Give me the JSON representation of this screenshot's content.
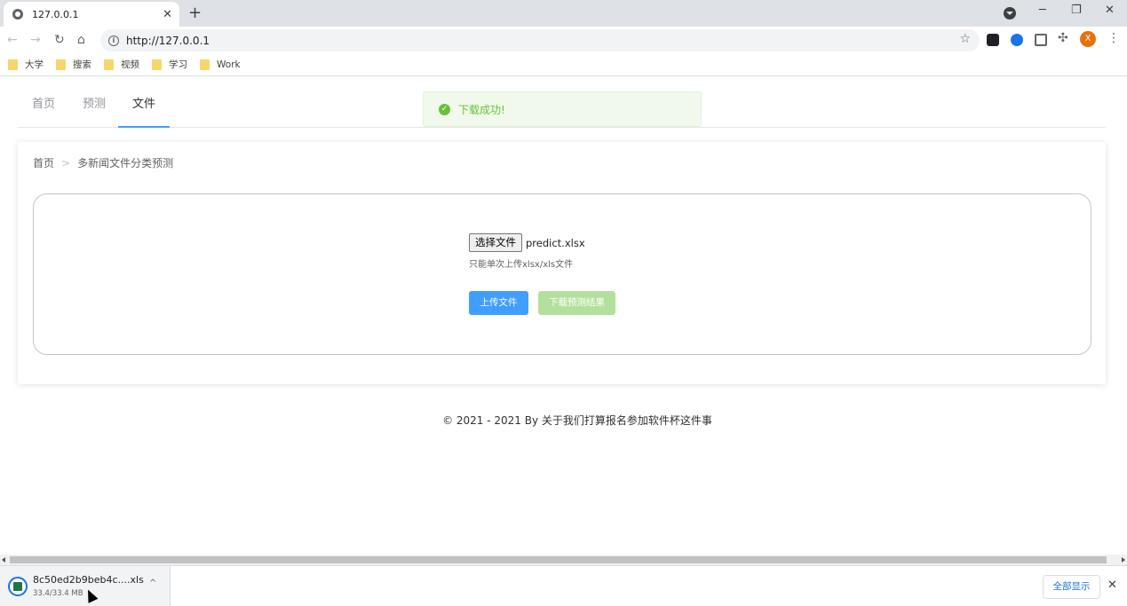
{
  "browser": {
    "tab_title": "127.0.0.1",
    "tab_close": "✕",
    "new_tab": "+",
    "url": "http://127.0.0.1",
    "info_glyph": "i",
    "star_glyph": "☆",
    "avatar_letter": "X",
    "min_glyph": "─",
    "max_glyph": "❐",
    "close_glyph": "✕",
    "back_glyph": "←",
    "forward_glyph": "→",
    "reload_glyph": "↻",
    "home_glyph": "⌂",
    "puzzle_glyph": "✣",
    "menu_glyph": "⋮"
  },
  "bookmarks": [
    {
      "label": "大学"
    },
    {
      "label": "搜索"
    },
    {
      "label": "视频"
    },
    {
      "label": "学习"
    },
    {
      "label": "Work"
    }
  ],
  "nav": {
    "items": [
      {
        "label": "首页"
      },
      {
        "label": "预测"
      },
      {
        "label": "文件"
      }
    ],
    "active_index": 2
  },
  "toast": {
    "text": "下载成功!",
    "check_glyph": "✓"
  },
  "breadcrumb": {
    "home": "首页",
    "separator": ">",
    "current": "多新闻文件分类预测"
  },
  "upload": {
    "choose_button": "选择文件",
    "file_name": "predict.xlsx",
    "hint": "只能单次上传xlsx/xls文件",
    "upload_button": "上传文件",
    "download_button": "下载预测结果"
  },
  "footer": {
    "text": "© 2021 - 2021 By 关于我们打算报名参加软件杯这件事"
  },
  "download_shelf": {
    "file_name": "8c50ed2b9beb4c....xls",
    "size": "33.4/33.4 MB",
    "caret_glyph": "^",
    "show_all": "全部显示",
    "close_glyph": "✕"
  },
  "colors": {
    "primary": "#409eff",
    "success": "#67c23a",
    "disabled_success": "#b3e19d"
  }
}
